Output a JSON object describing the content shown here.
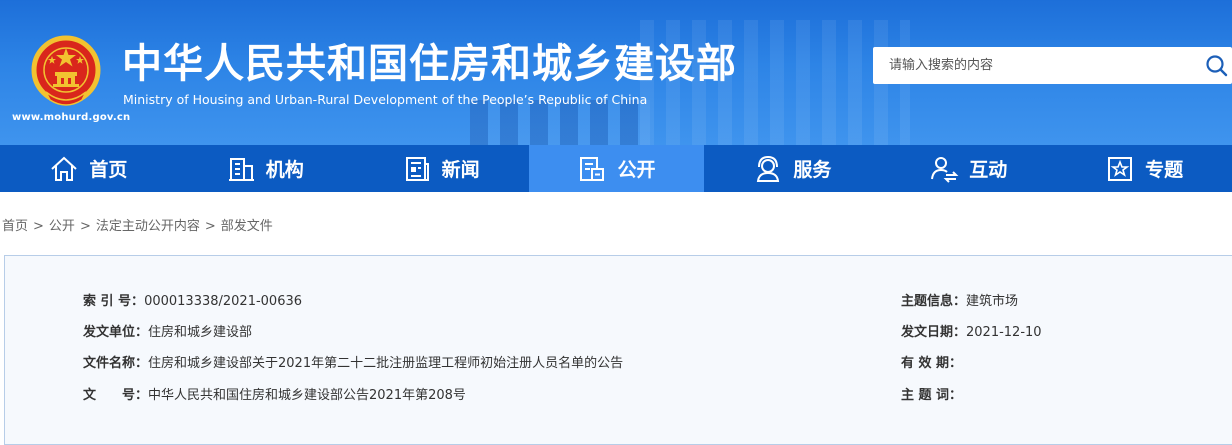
{
  "header": {
    "title": "中华人民共和国住房和城乡建设部",
    "subtitle": "Ministry of Housing and Urban-Rural Development of the People’s Republic of China",
    "domain": "www.mohurd.gov.cn",
    "colors": {
      "header_blue": "#2d84e6",
      "nav_blue": "#0c5bc2",
      "nav_active": "#3d8ef0"
    }
  },
  "search": {
    "placeholder": "请输入搜索的内容",
    "value": "",
    "icon": "search-icon"
  },
  "nav": {
    "items": [
      {
        "label": "首页",
        "icon": "home-icon",
        "active": false
      },
      {
        "label": "机构",
        "icon": "building-icon",
        "active": false
      },
      {
        "label": "新闻",
        "icon": "newspaper-icon",
        "active": false
      },
      {
        "label": "公开",
        "icon": "document-icon",
        "active": true
      },
      {
        "label": "服务",
        "icon": "service-icon",
        "active": false
      },
      {
        "label": "互动",
        "icon": "interaction-icon",
        "active": false
      },
      {
        "label": "专题",
        "icon": "star-icon",
        "active": false
      }
    ]
  },
  "breadcrumb": [
    "首页",
    "公开",
    "法定主动公开内容",
    "部发文件"
  ],
  "breadcrumb_separator": ">",
  "info": {
    "index_label": "索 引 号：",
    "index_value": "000013338/2021-00636",
    "topic_label": "主题信息：",
    "topic_value": "建筑市场",
    "issuer_label": "发文单位：",
    "issuer_value": "住房和城乡建设部",
    "date_label": "发文日期：",
    "date_value": "2021-12-10",
    "filename_label": "文件名称：",
    "filename_value": "住房和城乡建设部关于2021年第二十二批注册监理工程师初始注册人员名单的公告",
    "validity_label": "有 效 期：",
    "validity_value": "",
    "docno_label": "文　　号：",
    "docno_value": "中华人民共和国住房和城乡建设部公告2021年第208号",
    "keywords_label": "主 题 词：",
    "keywords_value": ""
  }
}
